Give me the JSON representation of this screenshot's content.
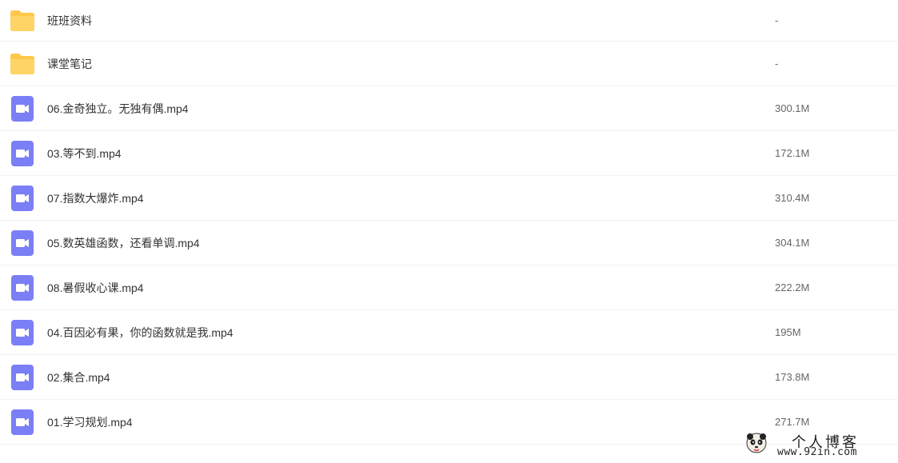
{
  "colors": {
    "folder": "#ffc74a",
    "video_icon": "#7b7ff5",
    "divider": "#f1f2f4"
  },
  "files": [
    {
      "name": "班班资料",
      "size": "-",
      "type": "folder",
      "icon": "folder-icon"
    },
    {
      "name": "课堂笔记",
      "size": "-",
      "type": "folder",
      "icon": "folder-icon"
    },
    {
      "name": "06.金奇独立。无独有偶.mp4",
      "size": "300.1M",
      "type": "video",
      "icon": "video-file-icon"
    },
    {
      "name": "03.等不到.mp4",
      "size": "172.1M",
      "type": "video",
      "icon": "video-file-icon"
    },
    {
      "name": "07.指数大爆炸.mp4",
      "size": "310.4M",
      "type": "video",
      "icon": "video-file-icon"
    },
    {
      "name": "05.数英雄函数，还看单调.mp4",
      "size": "304.1M",
      "type": "video",
      "icon": "video-file-icon"
    },
    {
      "name": "08.暑假收心课.mp4",
      "size": "222.2M",
      "type": "video",
      "icon": "video-file-icon"
    },
    {
      "name": "04.百因必有果，你的函数就是我.mp4",
      "size": "195M",
      "type": "video",
      "icon": "video-file-icon"
    },
    {
      "name": "02.集合.mp4",
      "size": "173.8M",
      "type": "video",
      "icon": "video-file-icon"
    },
    {
      "name": "01.学习规划.mp4",
      "size": "271.7M",
      "type": "video",
      "icon": "video-file-icon"
    }
  ],
  "watermark": {
    "title": "个人博客",
    "url": "www.92in.com"
  }
}
